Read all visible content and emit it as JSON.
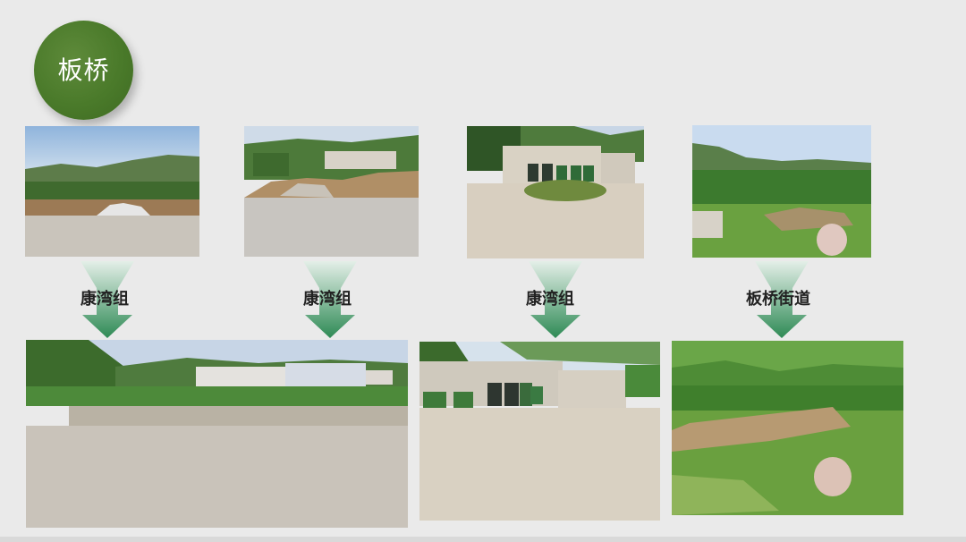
{
  "slide": {
    "title": "板桥",
    "accent_color": "#4a7a2a",
    "arrow_color": "#2e8a55"
  },
  "groups": [
    {
      "label": "康湾组",
      "before_photo": "before-photo-1",
      "after_photo": "after-photo-1"
    },
    {
      "label": "康湾组",
      "before_photo": "before-photo-2",
      "after_photo": "after-photo-2"
    },
    {
      "label": "康湾组",
      "before_photo": "before-photo-3",
      "after_photo": "after-photo-3"
    },
    {
      "label": "板桥街道",
      "before_photo": "before-photo-4",
      "after_photo": "after-photo-4"
    }
  ]
}
